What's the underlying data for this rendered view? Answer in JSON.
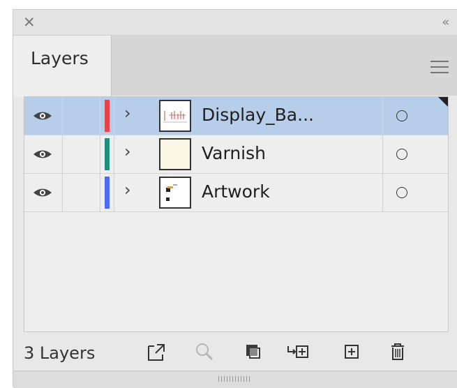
{
  "window": {
    "close_icon": "close-icon",
    "collapse_icon": "double-chevron-left-icon"
  },
  "tab": {
    "label": "Layers"
  },
  "layers": [
    {
      "name": "Display_Ba...",
      "color": "#e8434a",
      "selected": true
    },
    {
      "name": "Varnish",
      "color": "#1f8f7d",
      "selected": false
    },
    {
      "name": "Artwork",
      "color": "#4a6cf0",
      "selected": false
    }
  ],
  "footer": {
    "count": "3 Layers",
    "icons": [
      "export-icon",
      "locate-object-icon",
      "clipping-mask-icon",
      "new-sublayer-icon",
      "new-layer-icon",
      "trash-icon"
    ]
  }
}
